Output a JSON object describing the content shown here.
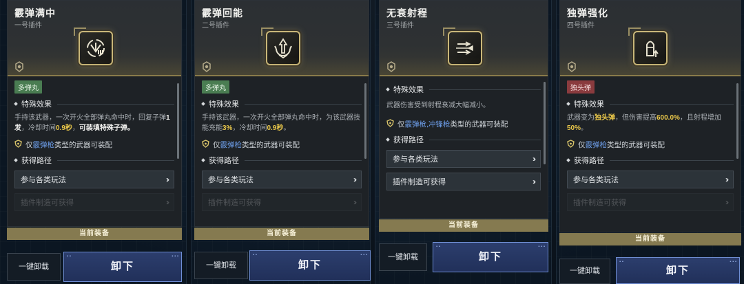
{
  "colors": {
    "gold": "#c9b779",
    "equip_bar": "#857a50",
    "tag_green": "#4a7d52",
    "tag_red": "#8a3b3e",
    "highlight_yellow": "#e9c74a",
    "weapon_blue": "#6fa1ef",
    "unload_button": "#2c3e6d"
  },
  "cards": [
    {
      "title": "霰弹满中",
      "slot": "一号插件",
      "icon": "spread-burst-icon",
      "tag": "多弹丸",
      "effect_heading": "特殊效果",
      "effect_parts": [
        "手持该武器，一次开火全部弹丸命中时，回复子弹",
        "1发",
        "，冷却时间",
        "0.9秒",
        "，",
        "可装填特殊子弹。"
      ],
      "weapon_prefix": "仅",
      "weapon_types": "霰弹枪",
      "weapon_suffix": "类型的武器可装配",
      "route_heading": "获得路径",
      "routes": [
        "参与各类玩法",
        "插件制造可获得"
      ],
      "equip_label": "当前装备",
      "unload_all": "一键卸载",
      "unload": "卸下"
    },
    {
      "title": "霰弹回能",
      "slot": "二号插件",
      "icon": "energy-return-icon",
      "tag": "多弹丸",
      "effect_heading": "特殊效果",
      "effect_parts": [
        "手持该武器，一次开火全部弹丸命中时，为该武器技能充能",
        "3%",
        "，冷却时间",
        "0.9秒",
        "。"
      ],
      "weapon_prefix": "仅",
      "weapon_types": "霰弹枪",
      "weapon_suffix": "类型的武器可装配",
      "route_heading": "获得路径",
      "routes": [
        "参与各类玩法",
        "插件制造可获得"
      ],
      "equip_label": "当前装备",
      "unload_all": "一键卸载",
      "unload": "卸下"
    },
    {
      "title": "无衰射程",
      "slot": "三号插件",
      "icon": "long-range-icon",
      "effect_heading": "特殊效果",
      "effect_text": "武器伤害受到射程衰减大幅减小。",
      "weapon_prefix": "仅",
      "weapon_types": "霰弹枪,冲锋枪",
      "weapon_suffix": "类型的武器可装配",
      "route_heading": "获得路径",
      "routes": [
        "参与各类玩法",
        "插件制造可获得"
      ],
      "equip_label": "当前装备",
      "unload_all": "一键卸载",
      "unload": "卸下"
    },
    {
      "title": "独弹强化",
      "slot": "四号插件",
      "icon": "slug-round-icon",
      "tag": "独头弹",
      "effect_heading": "特殊效果",
      "effect_parts": [
        "武器变为",
        "独头弹",
        "，但伤害提高",
        "600.0%",
        "，且射程增加",
        "50%",
        "。"
      ],
      "weapon_prefix": "仅",
      "weapon_types": "霰弹枪",
      "weapon_suffix": "类型的武器可装配",
      "route_heading": "获得路径",
      "routes": [
        "参与各类玩法",
        "插件制造可获得"
      ],
      "equip_label": "当前装备",
      "unload_all": "一键卸载",
      "unload": "卸下"
    }
  ]
}
